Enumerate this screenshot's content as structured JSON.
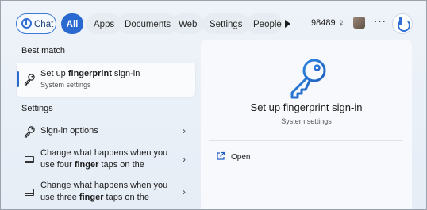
{
  "top_bar": {
    "chat_label": "Chat",
    "filters": [
      "All",
      "Apps",
      "Documents",
      "Web",
      "Settings",
      "People"
    ],
    "points": "98489"
  },
  "best_match": {
    "section_label": "Best match",
    "title_prefix": "Set up ",
    "title_bold": "fingerprint",
    "title_suffix": " sign-in",
    "subtitle": "System settings"
  },
  "settings_section": {
    "section_label": "Settings",
    "items": [
      {
        "line1": "Sign-in options",
        "line2_prefix": "",
        "line2_bold": "",
        "line2_suffix": ""
      },
      {
        "line1": "Change what happens when you",
        "line2_prefix": "use four ",
        "line2_bold": "finger",
        "line2_suffix": " taps on the"
      },
      {
        "line1": "Change what happens when you",
        "line2_prefix": "use three ",
        "line2_bold": "finger",
        "line2_suffix": " taps on the"
      }
    ]
  },
  "detail_panel": {
    "title": "Set up fingerprint sign-in",
    "subtitle": "System settings",
    "actions": [
      {
        "label": "Open",
        "icon": "open-external-icon"
      }
    ]
  },
  "colors": {
    "accent": "#2a6ad0",
    "background": "#e9eef5",
    "panel": "#f7f9fc"
  }
}
